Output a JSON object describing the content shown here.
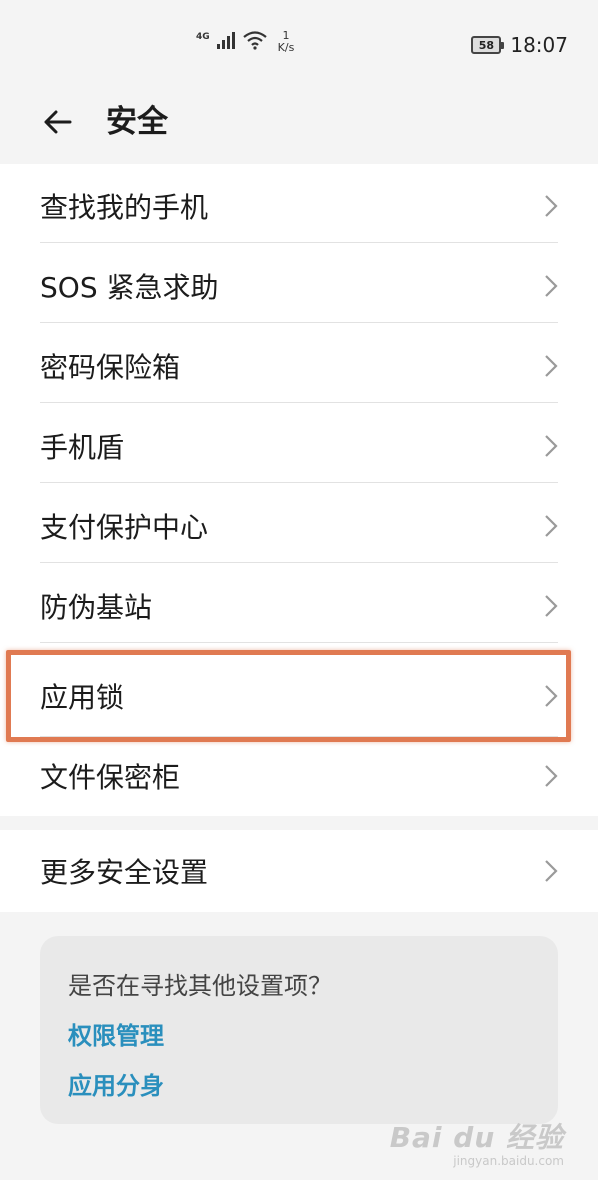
{
  "status_bar": {
    "network": "4G",
    "speed_value": "1",
    "speed_unit": "K/s",
    "battery": "58",
    "time": "18:07"
  },
  "header": {
    "title": "安全"
  },
  "menu": {
    "items": [
      {
        "label": "查找我的手机"
      },
      {
        "label": "SOS 紧急求助"
      },
      {
        "label": "密码保险箱"
      },
      {
        "label": "手机盾"
      },
      {
        "label": "支付保护中心"
      },
      {
        "label": "防伪基站"
      },
      {
        "label": "应用锁"
      },
      {
        "label": "文件保密柜"
      }
    ],
    "more": {
      "label": "更多安全设置"
    }
  },
  "suggestions": {
    "title": "是否在寻找其他设置项？",
    "links": [
      "权限管理",
      "应用分身"
    ]
  },
  "watermark": {
    "logo": "Bai du 经验",
    "url": "jingyan.baidu.com"
  },
  "colors": {
    "accent": "#2a8fbd",
    "highlight": "#e07a52"
  }
}
